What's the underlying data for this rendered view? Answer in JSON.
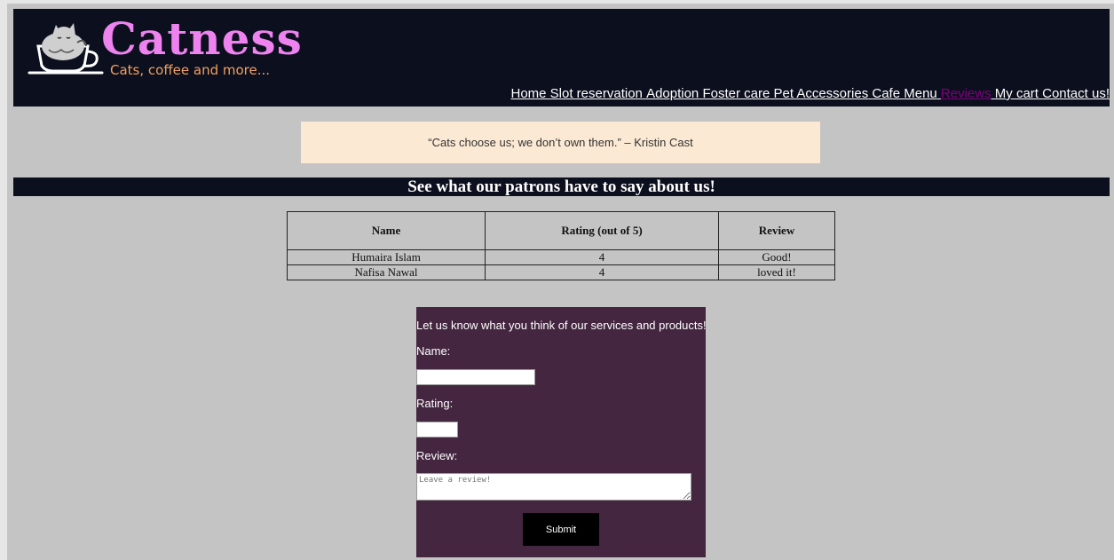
{
  "header": {
    "brand": "Catness",
    "tagline": "Cats, coffee and more...",
    "logo_icon": "cat-in-cup-icon",
    "nav": [
      {
        "label": "Home",
        "active": false
      },
      {
        "label": "Slot reservation",
        "active": false
      },
      {
        "label": "Adoption",
        "active": false
      },
      {
        "label": "Foster care",
        "active": false
      },
      {
        "label": "Pet Accessories",
        "active": false
      },
      {
        "label": "Cafe Menu",
        "active": false
      },
      {
        "label": "Reviews",
        "active": true
      },
      {
        "label": "My cart",
        "active": false
      },
      {
        "label": "Contact us!",
        "active": false
      }
    ]
  },
  "quote": "“Cats choose us; we don’t own them.” – Kristin Cast",
  "banner": "See what our patrons have to say about us!",
  "reviews_table": {
    "headers": [
      "Name",
      "Rating (out of 5)",
      "Review"
    ],
    "rows": [
      [
        "Humaira Islam",
        "4",
        "Good!"
      ],
      [
        "Nafisa Nawal",
        "4",
        "loved it!"
      ]
    ]
  },
  "form": {
    "intro": "Let us know what you think of our services and products!",
    "name_label": "Name:",
    "name_value": "",
    "rating_label": "Rating:",
    "rating_value": "",
    "review_label": "Review:",
    "review_placeholder": "Leave a review!",
    "submit_label": "Submit"
  },
  "colors": {
    "header_bg": "#0c0f1e",
    "brand": "#ee82ee",
    "tagline": "#f0a060",
    "active_nav": "#800080",
    "quote_bg": "#fbe9d4",
    "form_bg": "#442640"
  }
}
